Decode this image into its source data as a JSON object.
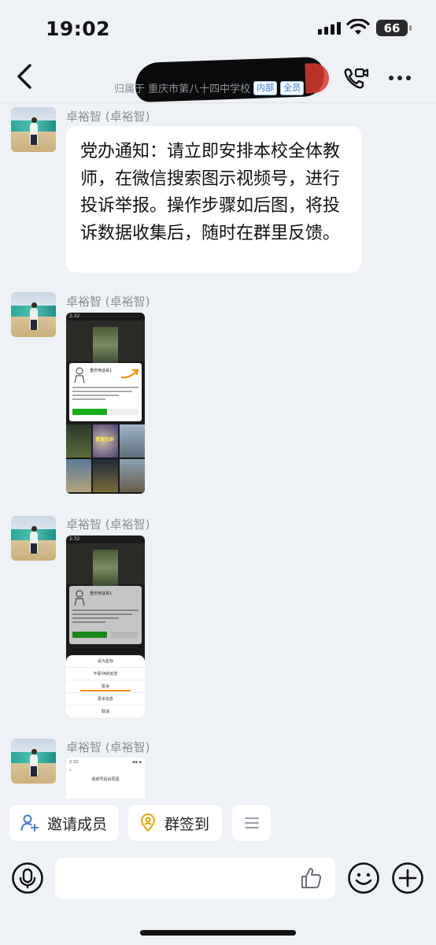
{
  "status_bar": {
    "time": "19:02",
    "battery": "66"
  },
  "header": {
    "subtitle": "归属于 重庆市第八十四中学校",
    "tag_internal": "内部",
    "tag_all": "全员"
  },
  "messages": [
    {
      "sender": "卓裕智 (卓裕智)",
      "text": "党办通知：请立即安排本校全体教师，在微信搜索图示视频号，进行投诉举报。操作步骤如后图，将投诉数据收集后，随时在群里反馈。"
    },
    {
      "sender": "卓裕智 (卓裕智)",
      "image": {
        "status_time": "2:32",
        "card_title": "重庆电话哥1",
        "grid_label": "重案在即"
      }
    },
    {
      "sender": "卓裕智 (卓裕智)",
      "image": {
        "status_time": "2:32",
        "card_title": "重庆电话哥1",
        "menu_items": [
          "设为星标",
          "不看TA的动态",
          "投诉",
          "更多信息",
          "取消"
        ]
      }
    },
    {
      "sender": "卓裕智 (卓裕智)",
      "image": {
        "status_time": "2:32",
        "page_title": "视频号投诉原因"
      }
    }
  ],
  "quick_actions": {
    "invite": "邀请成员",
    "checkin": "群签到"
  },
  "input": {
    "placeholder": ""
  },
  "colors": {
    "background": "#eef1f5",
    "accent_orange": "#f0a200",
    "accent_blue": "#3d7fd9"
  }
}
